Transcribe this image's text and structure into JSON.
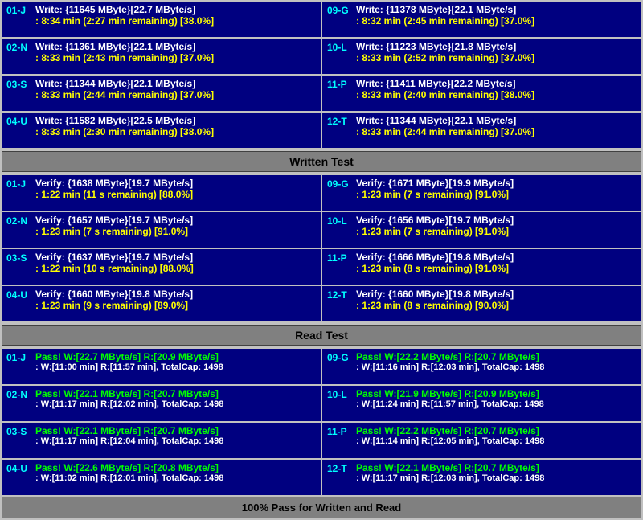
{
  "sections": {
    "write": {
      "rows": [
        {
          "left": {
            "id": "01-J",
            "line1": "Write: {11645 MByte}[22.7 MByte/s]",
            "line2": "8:34 min (2:27 min remaining)  [38.0%]"
          },
          "right": {
            "id": "09-G",
            "line1": "Write: {11378 MByte}[22.1 MByte/s]",
            "line2": "8:32 min (2:45 min remaining)  [37.0%]"
          }
        },
        {
          "left": {
            "id": "02-N",
            "line1": "Write: {11361 MByte}[22.1 MByte/s]",
            "line2": "8:33 min (2:43 min remaining)  [37.0%]"
          },
          "right": {
            "id": "10-L",
            "line1": "Write: {11223 MByte}[21.8 MByte/s]",
            "line2": "8:33 min (2:52 min remaining)  [37.0%]"
          }
        },
        {
          "left": {
            "id": "03-S",
            "line1": "Write: {11344 MByte}[22.1 MByte/s]",
            "line2": "8:33 min (2:44 min remaining)  [37.0%]"
          },
          "right": {
            "id": "11-P",
            "line1": "Write: {11411 MByte}[22.2 MByte/s]",
            "line2": "8:33 min (2:40 min remaining)  [38.0%]"
          }
        },
        {
          "left": {
            "id": "04-U",
            "line1": "Write: {11582 MByte}[22.5 MByte/s]",
            "line2": "8:33 min (2:30 min remaining)  [38.0%]"
          },
          "right": {
            "id": "12-T",
            "line1": "Write: {11344 MByte}[22.1 MByte/s]",
            "line2": "8:33 min (2:44 min remaining)  [37.0%]"
          }
        }
      ],
      "label": "Written Test"
    },
    "verify": {
      "rows": [
        {
          "left": {
            "id": "01-J",
            "line1": "Verify: {1638 MByte}[19.7 MByte/s]",
            "line2": "1:22 min (11 s remaining)   [88.0%]"
          },
          "right": {
            "id": "09-G",
            "line1": "Verify: {1671 MByte}[19.9 MByte/s]",
            "line2": "1:23 min (7 s remaining)   [91.0%]"
          }
        },
        {
          "left": {
            "id": "02-N",
            "line1": "Verify: {1657 MByte}[19.7 MByte/s]",
            "line2": "1:23 min (7 s remaining)   [91.0%]"
          },
          "right": {
            "id": "10-L",
            "line1": "Verify: {1656 MByte}[19.7 MByte/s]",
            "line2": "1:23 min (7 s remaining)   [91.0%]"
          }
        },
        {
          "left": {
            "id": "03-S",
            "line1": "Verify: {1637 MByte}[19.7 MByte/s]",
            "line2": "1:22 min (10 s remaining)   [88.0%]"
          },
          "right": {
            "id": "11-P",
            "line1": "Verify: {1666 MByte}[19.8 MByte/s]",
            "line2": "1:23 min (8 s remaining)   [91.0%]"
          }
        },
        {
          "left": {
            "id": "04-U",
            "line1": "Verify: {1660 MByte}[19.8 MByte/s]",
            "line2": "1:23 min (9 s remaining)   [89.0%]"
          },
          "right": {
            "id": "12-T",
            "line1": "Verify: {1660 MByte}[19.8 MByte/s]",
            "line2": "1:23 min (8 s remaining)   [90.0%]"
          }
        }
      ],
      "label": "Read Test"
    },
    "pass": {
      "rows": [
        {
          "left": {
            "id": "01-J",
            "line1": "Pass! W:[22.7 MByte/s] R:[20.9 MByte/s]",
            "line2": "W:[11:00 min] R:[11:57 min], TotalCap: 1498"
          },
          "right": {
            "id": "09-G",
            "line1": "Pass! W:[22.2 MByte/s] R:[20.7 MByte/s]",
            "line2": "W:[11:16 min] R:[12:03 min], TotalCap: 1498"
          }
        },
        {
          "left": {
            "id": "02-N",
            "line1": "Pass! W:[22.1 MByte/s] R:[20.7 MByte/s]",
            "line2": "W:[11:17 min] R:[12:02 min], TotalCap: 1498"
          },
          "right": {
            "id": "10-L",
            "line1": "Pass! W:[21.9 MByte/s] R:[20.9 MByte/s]",
            "line2": "W:[11:24 min] R:[11:57 min], TotalCap: 1498"
          }
        },
        {
          "left": {
            "id": "03-S",
            "line1": "Pass! W:[22.1 MByte/s] R:[20.7 MByte/s]",
            "line2": "W:[11:17 min] R:[12:04 min], TotalCap: 1498"
          },
          "right": {
            "id": "11-P",
            "line1": "Pass! W:[22.2 MByte/s] R:[20.7 MByte/s]",
            "line2": "W:[11:14 min] R:[12:05 min], TotalCap: 1498"
          }
        },
        {
          "left": {
            "id": "04-U",
            "line1": "Pass! W:[22.6 MByte/s] R:[20.8 MByte/s]",
            "line2": "W:[11:02 min] R:[12:01 min], TotalCap: 1498"
          },
          "right": {
            "id": "12-T",
            "line1": "Pass! W:[22.1 MByte/s] R:[20.7 MByte/s]",
            "line2": "W:[11:17 min] R:[12:03 min], TotalCap: 1498"
          }
        }
      ]
    }
  },
  "footer": {
    "text": "100% Pass for Written and Read"
  }
}
